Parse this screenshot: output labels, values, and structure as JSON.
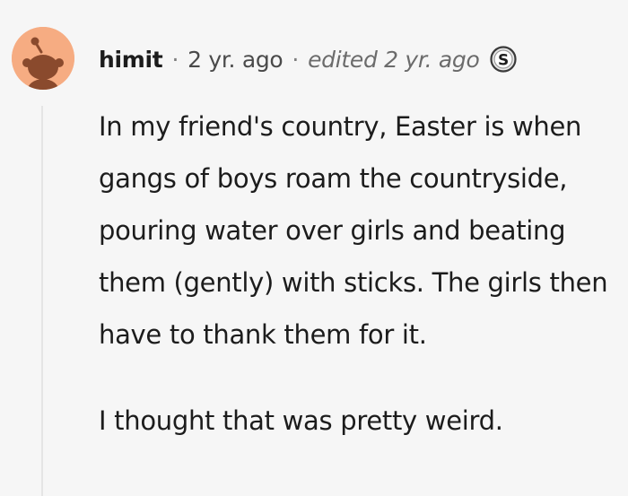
{
  "comment": {
    "username": "himit",
    "separator": "·",
    "time": "2 yr. ago",
    "edited": "edited 2 yr. ago",
    "badge_icon": "silver-award-icon",
    "paragraphs": [
      "In my friend's country, Easter is when gangs of boys roam the countryside, pouring water over girls and beating them (gently) with sticks. The girls then have to thank them for it.",
      "I thought that was pretty weird."
    ]
  },
  "avatar": {
    "icon": "snoo-avatar-icon",
    "background_color": "#f6ac82",
    "figure_color": "#8a4a2d"
  }
}
